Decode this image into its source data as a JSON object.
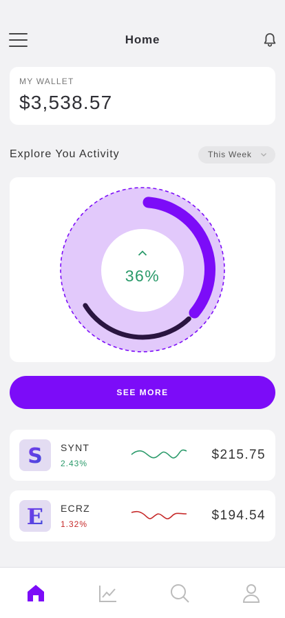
{
  "header": {
    "title": "Home",
    "menu_icon": "hamburger-menu-icon",
    "notification_icon": "bell-icon"
  },
  "wallet": {
    "label": "MY WALLET",
    "amount": "$3,538.57"
  },
  "activity": {
    "heading": "Explore You Activity",
    "period": "This Week",
    "change_percent": "36%",
    "progress_fraction": 0.36,
    "trend": "up"
  },
  "see_more": "SEE MORE",
  "assets": [
    {
      "ticker": "SYNT",
      "change": "2.43%",
      "price": "$215.75",
      "logo_letter": "S",
      "trend_color": "#2a9a6a"
    },
    {
      "ticker": "ECRZ",
      "change": "1.32%",
      "price": "$194.54",
      "logo_letter": "E",
      "trend_color": "#c62828"
    }
  ],
  "tabs": [
    "home-icon",
    "chart-icon",
    "search-icon",
    "profile-icon"
  ],
  "colors": {
    "accent": "#7c0cf8",
    "accent_light": "#e2c9fb",
    "positive": "#2a9a6a",
    "negative": "#c62828"
  }
}
